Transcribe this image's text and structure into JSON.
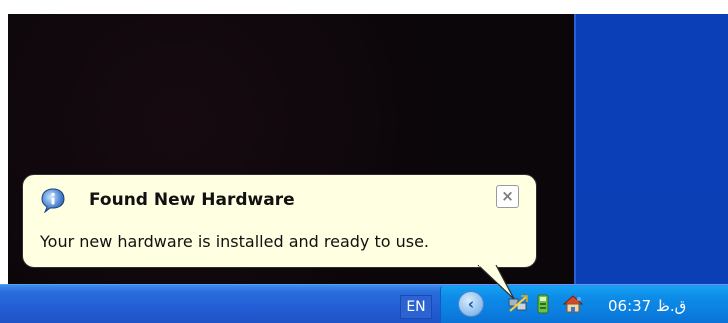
{
  "balloon": {
    "title": "Found New Hardware",
    "message": "Your new hardware is installed and ready to use.",
    "close_glyph": "×",
    "icon": "info-icon"
  },
  "taskbar": {
    "language": "EN",
    "clock": "06:37 ق.ظ",
    "tray_chevron_glyph": "‹",
    "tray_icons": [
      "network-connection-icon",
      "safely-remove-hardware-icon",
      "home-network-icon"
    ]
  },
  "colors": {
    "balloon_bg": "#ffffe1",
    "taskbar_blue": "#245ed6",
    "tray_blue": "#0b7fe0",
    "desktop_blue": "#0b3fb6",
    "window_dark": "#0b060a"
  }
}
